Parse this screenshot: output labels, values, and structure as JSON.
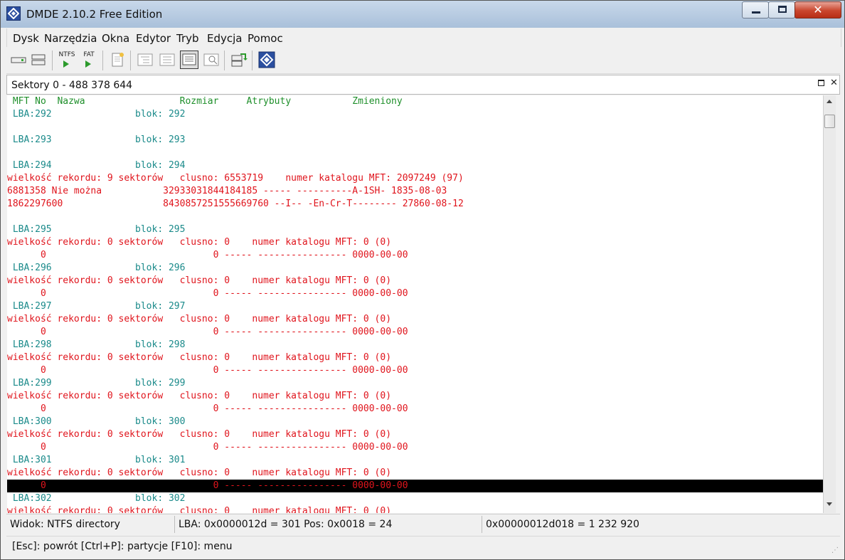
{
  "window": {
    "title": "DMDE 2.10.2 Free Edition"
  },
  "menu": [
    "Dysk",
    "Narzędzia",
    "Okna",
    "Edytor",
    "Tryb",
    "Edycja",
    "Pomoc"
  ],
  "toolbar": {
    "ntfs_label": "NTFS",
    "fat_label": "FAT"
  },
  "panel": {
    "title": "Sektory 0 - 488 378 644",
    "close_glyph": "✕"
  },
  "colors": {
    "header": "#1e8f2a",
    "lba": "#1a8a8a",
    "record": "#e0141c",
    "selection_bg": "#000000"
  },
  "listing": {
    "header": " MFT No  Nazwa                 Rozmiar     Atrybuty           Zmieniony",
    "lines": [
      {
        "kind": "lba",
        "text": " LBA:292               blok: 292"
      },
      {
        "kind": "blank",
        "text": ""
      },
      {
        "kind": "lba",
        "text": " LBA:293               blok: 293"
      },
      {
        "kind": "blank",
        "text": ""
      },
      {
        "kind": "lba",
        "text": " LBA:294               blok: 294"
      },
      {
        "kind": "red",
        "text": "wielkość rekordu: 9 sektorów   clusno: 6553719    numer katalogu MFT: 2097249 (97)"
      },
      {
        "kind": "red",
        "text": "6881358 Nie można           32933031844184185 ----- ----------A-1SH- 1835-08-03"
      },
      {
        "kind": "red",
        "text": "1862297600                  8430857251555669760 --I-- -En-Cr-T-------- 27860-08-12"
      },
      {
        "kind": "blank",
        "text": ""
      },
      {
        "kind": "lba",
        "text": " LBA:295               blok: 295"
      },
      {
        "kind": "red",
        "text": "wielkość rekordu: 0 sektorów   clusno: 0    numer katalogu MFT: 0 (0)"
      },
      {
        "kind": "red",
        "text": "      0                              0 ----- ---------------- 0000-00-00"
      },
      {
        "kind": "lba",
        "text": " LBA:296               blok: 296"
      },
      {
        "kind": "red",
        "text": "wielkość rekordu: 0 sektorów   clusno: 0    numer katalogu MFT: 0 (0)"
      },
      {
        "kind": "red",
        "text": "      0                              0 ----- ---------------- 0000-00-00"
      },
      {
        "kind": "lba",
        "text": " LBA:297               blok: 297"
      },
      {
        "kind": "red",
        "text": "wielkość rekordu: 0 sektorów   clusno: 0    numer katalogu MFT: 0 (0)"
      },
      {
        "kind": "red",
        "text": "      0                              0 ----- ---------------- 0000-00-00"
      },
      {
        "kind": "lba",
        "text": " LBA:298               blok: 298"
      },
      {
        "kind": "red",
        "text": "wielkość rekordu: 0 sektorów   clusno: 0    numer katalogu MFT: 0 (0)"
      },
      {
        "kind": "red",
        "text": "      0                              0 ----- ---------------- 0000-00-00"
      },
      {
        "kind": "lba",
        "text": " LBA:299               blok: 299"
      },
      {
        "kind": "red",
        "text": "wielkość rekordu: 0 sektorów   clusno: 0    numer katalogu MFT: 0 (0)"
      },
      {
        "kind": "red",
        "text": "      0                              0 ----- ---------------- 0000-00-00"
      },
      {
        "kind": "lba",
        "text": " LBA:300               blok: 300"
      },
      {
        "kind": "red",
        "text": "wielkość rekordu: 0 sektorów   clusno: 0    numer katalogu MFT: 0 (0)"
      },
      {
        "kind": "red",
        "text": "      0                              0 ----- ---------------- 0000-00-00"
      },
      {
        "kind": "lba",
        "text": " LBA:301               blok: 301"
      },
      {
        "kind": "red",
        "text": "wielkość rekordu: 0 sektorów   clusno: 0    numer katalogu MFT: 0 (0)"
      },
      {
        "kind": "red",
        "text": "      0                              0 ----- ---------------- 0000-00-00",
        "selected": true
      },
      {
        "kind": "lba",
        "text": " LBA:302               blok: 302"
      },
      {
        "kind": "red",
        "text": "wielkość rekordu: 0 sektorów   clusno: 0    numer katalogu MFT: 0 (0)"
      }
    ]
  },
  "status": {
    "view": "Widok: NTFS directory",
    "position": "LBA: 0x0000012d = 301  Pos: 0x0018 = 24",
    "offset": "0x00000012d018 = 1 232 920"
  },
  "hints": "[Esc]: powrót  [Ctrl+P]: partycje  [F10]: menu"
}
